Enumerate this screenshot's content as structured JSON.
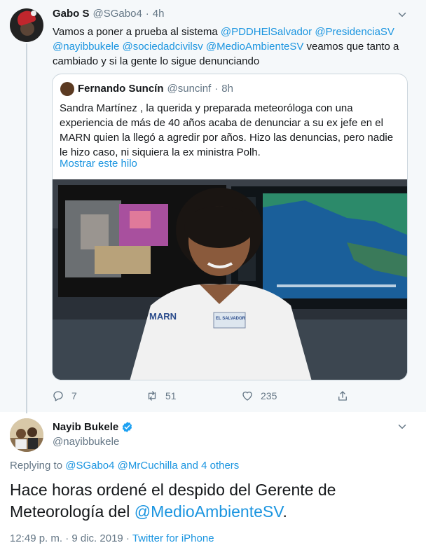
{
  "top_tweet": {
    "name": "Gabo S",
    "handle": "@SGabo4",
    "sep": "·",
    "time": "4h",
    "text_lines": [
      {
        "parts": [
          {
            "t": "Vamos a poner a prueba al sistema ",
            "m": false
          },
          {
            "t": "@PDDHElSalvador",
            "m": true
          },
          {
            "t": " ",
            "m": false
          },
          {
            "t": "@PresidenciaSV",
            "m": true
          }
        ]
      },
      {
        "parts": [
          {
            "t": "@nayibbukele",
            "m": true
          },
          {
            "t": " ",
            "m": false
          },
          {
            "t": "@sociedadcivilsv",
            "m": true
          },
          {
            "t": " ",
            "m": false
          },
          {
            "t": "@MedioAmbienteSV",
            "m": true
          },
          {
            "t": " veamos que tanto a",
            "m": false
          }
        ]
      },
      {
        "parts": [
          {
            "t": "cambiado y si la gente lo sigue denunciando",
            "m": false
          }
        ]
      }
    ],
    "quote": {
      "name": "Fernando Suncín",
      "handle": "@suncinf",
      "sep": "·",
      "time": "8h",
      "text_lines": [
        "Sandra Martínez , la querida y preparada meteoróloga con una",
        "experiencia de más de 40 años acaba de denunciar a su ex jefe en el",
        "MARN quien la llegó a agredir por años. Hizo las denuncias, pero nadie",
        "le hizo caso, ni siquiera la ex ministra Polh."
      ],
      "show_thread": "Mostrar este hilo",
      "shirt_text": "MARN",
      "badge_text": "EL SALVADOR"
    },
    "actions": {
      "replies": "7",
      "retweets": "51",
      "likes": "235"
    }
  },
  "main_tweet": {
    "name": "Nayib Bukele",
    "handle": "@nayibbukele",
    "replying_prefix": "Replying to ",
    "replying_to": "@SGabo4 @MrCuchilla",
    "replying_suffix": " and 4 others",
    "text_part1": "Hace horas ordené el despido del Gerente de",
    "text_part2": "Meteorología del ",
    "text_mention": "@MedioAmbienteSV",
    "text_part3": ".",
    "timestamp": "12:49 p. m. · 9 dic. 2019",
    "meta_sep": " · ",
    "source": "Twitter for iPhone"
  },
  "colors": {
    "link": "#1b95e0",
    "muted": "#657786",
    "thread_bg": "#f5f8fa",
    "border": "#ccd6dd"
  }
}
